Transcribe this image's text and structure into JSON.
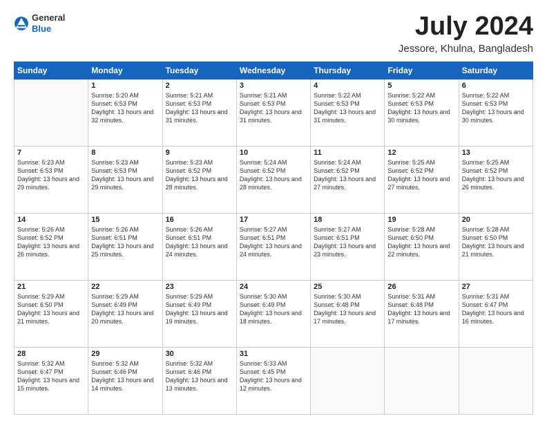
{
  "header": {
    "logo_general": "General",
    "logo_blue": "Blue",
    "month_title": "July 2024",
    "location": "Jessore, Khulna, Bangladesh"
  },
  "calendar": {
    "days_of_week": [
      "Sunday",
      "Monday",
      "Tuesday",
      "Wednesday",
      "Thursday",
      "Friday",
      "Saturday"
    ],
    "weeks": [
      [
        {
          "day": "",
          "info": ""
        },
        {
          "day": "1",
          "info": "Sunrise: 5:20 AM\nSunset: 6:53 PM\nDaylight: 13 hours\nand 32 minutes."
        },
        {
          "day": "2",
          "info": "Sunrise: 5:21 AM\nSunset: 6:53 PM\nDaylight: 13 hours\nand 31 minutes."
        },
        {
          "day": "3",
          "info": "Sunrise: 5:21 AM\nSunset: 6:53 PM\nDaylight: 13 hours\nand 31 minutes."
        },
        {
          "day": "4",
          "info": "Sunrise: 5:22 AM\nSunset: 6:53 PM\nDaylight: 13 hours\nand 31 minutes."
        },
        {
          "day": "5",
          "info": "Sunrise: 5:22 AM\nSunset: 6:53 PM\nDaylight: 13 hours\nand 30 minutes."
        },
        {
          "day": "6",
          "info": "Sunrise: 5:22 AM\nSunset: 6:53 PM\nDaylight: 13 hours\nand 30 minutes."
        }
      ],
      [
        {
          "day": "7",
          "info": "Sunrise: 5:23 AM\nSunset: 6:53 PM\nDaylight: 13 hours\nand 29 minutes."
        },
        {
          "day": "8",
          "info": "Sunrise: 5:23 AM\nSunset: 6:53 PM\nDaylight: 13 hours\nand 29 minutes."
        },
        {
          "day": "9",
          "info": "Sunrise: 5:23 AM\nSunset: 6:52 PM\nDaylight: 13 hours\nand 28 minutes."
        },
        {
          "day": "10",
          "info": "Sunrise: 5:24 AM\nSunset: 6:52 PM\nDaylight: 13 hours\nand 28 minutes."
        },
        {
          "day": "11",
          "info": "Sunrise: 5:24 AM\nSunset: 6:52 PM\nDaylight: 13 hours\nand 27 minutes."
        },
        {
          "day": "12",
          "info": "Sunrise: 5:25 AM\nSunset: 6:52 PM\nDaylight: 13 hours\nand 27 minutes."
        },
        {
          "day": "13",
          "info": "Sunrise: 5:25 AM\nSunset: 6:52 PM\nDaylight: 13 hours\nand 26 minutes."
        }
      ],
      [
        {
          "day": "14",
          "info": "Sunrise: 5:26 AM\nSunset: 6:52 PM\nDaylight: 13 hours\nand 26 minutes."
        },
        {
          "day": "15",
          "info": "Sunrise: 5:26 AM\nSunset: 6:51 PM\nDaylight: 13 hours\nand 25 minutes."
        },
        {
          "day": "16",
          "info": "Sunrise: 5:26 AM\nSunset: 6:51 PM\nDaylight: 13 hours\nand 24 minutes."
        },
        {
          "day": "17",
          "info": "Sunrise: 5:27 AM\nSunset: 6:51 PM\nDaylight: 13 hours\nand 24 minutes."
        },
        {
          "day": "18",
          "info": "Sunrise: 5:27 AM\nSunset: 6:51 PM\nDaylight: 13 hours\nand 23 minutes."
        },
        {
          "day": "19",
          "info": "Sunrise: 5:28 AM\nSunset: 6:50 PM\nDaylight: 13 hours\nand 22 minutes."
        },
        {
          "day": "20",
          "info": "Sunrise: 5:28 AM\nSunset: 6:50 PM\nDaylight: 13 hours\nand 21 minutes."
        }
      ],
      [
        {
          "day": "21",
          "info": "Sunrise: 5:29 AM\nSunset: 6:50 PM\nDaylight: 13 hours\nand 21 minutes."
        },
        {
          "day": "22",
          "info": "Sunrise: 5:29 AM\nSunset: 6:49 PM\nDaylight: 13 hours\nand 20 minutes."
        },
        {
          "day": "23",
          "info": "Sunrise: 5:29 AM\nSunset: 6:49 PM\nDaylight: 13 hours\nand 19 minutes."
        },
        {
          "day": "24",
          "info": "Sunrise: 5:30 AM\nSunset: 6:49 PM\nDaylight: 13 hours\nand 18 minutes."
        },
        {
          "day": "25",
          "info": "Sunrise: 5:30 AM\nSunset: 6:48 PM\nDaylight: 13 hours\nand 17 minutes."
        },
        {
          "day": "26",
          "info": "Sunrise: 5:31 AM\nSunset: 6:48 PM\nDaylight: 13 hours\nand 17 minutes."
        },
        {
          "day": "27",
          "info": "Sunrise: 5:31 AM\nSunset: 6:47 PM\nDaylight: 13 hours\nand 16 minutes."
        }
      ],
      [
        {
          "day": "28",
          "info": "Sunrise: 5:32 AM\nSunset: 6:47 PM\nDaylight: 13 hours\nand 15 minutes."
        },
        {
          "day": "29",
          "info": "Sunrise: 5:32 AM\nSunset: 6:46 PM\nDaylight: 13 hours\nand 14 minutes."
        },
        {
          "day": "30",
          "info": "Sunrise: 5:32 AM\nSunset: 6:46 PM\nDaylight: 13 hours\nand 13 minutes."
        },
        {
          "day": "31",
          "info": "Sunrise: 5:33 AM\nSunset: 6:45 PM\nDaylight: 13 hours\nand 12 minutes."
        },
        {
          "day": "",
          "info": ""
        },
        {
          "day": "",
          "info": ""
        },
        {
          "day": "",
          "info": ""
        }
      ]
    ]
  }
}
